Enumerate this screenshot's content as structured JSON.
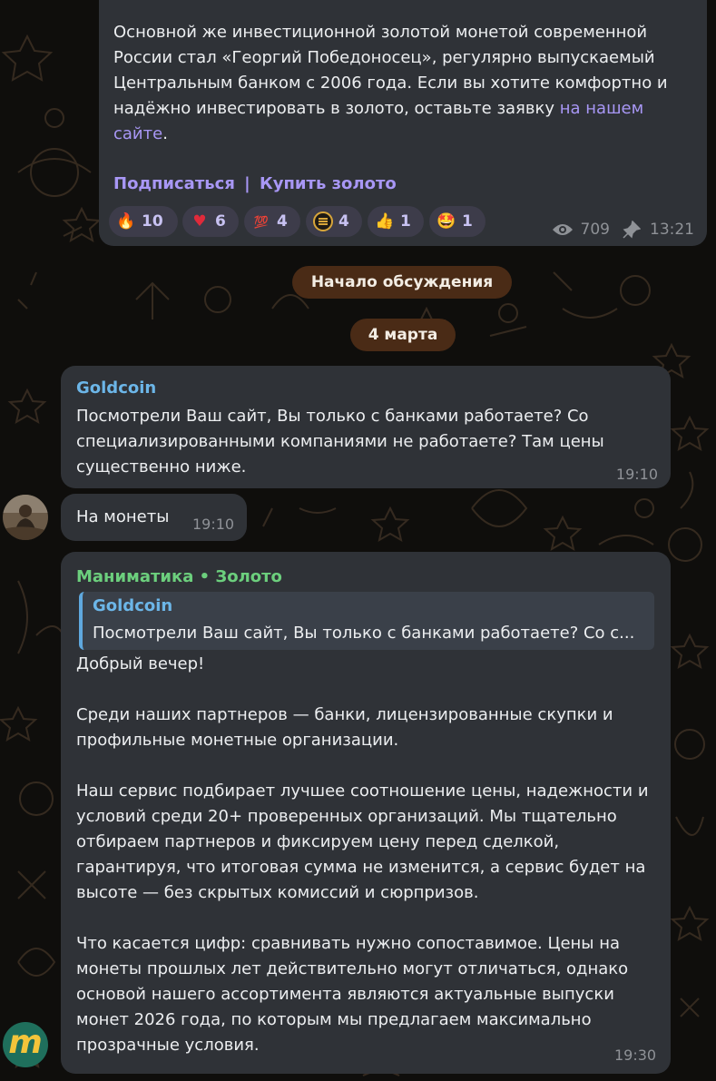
{
  "post": {
    "text": "Основной же инвестиционной золотой монетой современной России стал «Георгий Победоносец», регулярно выпускаемый Центральным банком с 2006 года. Если вы хотите комфортно и надёжно инвестировать в золото, оставьте заявку ",
    "link_text": "на нашем сайте",
    "link_suffix": ".",
    "subscribe_label": "Подписаться",
    "separator": "|",
    "buy_label": "Купить золото",
    "reactions": [
      {
        "icon": "fire-emoji",
        "emoji": "🔥",
        "count": "10"
      },
      {
        "icon": "heart-emoji",
        "emoji": "♥",
        "count": "6"
      },
      {
        "icon": "hundred-emoji",
        "emoji": "💯",
        "count": "4"
      },
      {
        "icon": "gold-logo-emoji",
        "emoji": "",
        "count": "4"
      },
      {
        "icon": "thumbs-up-emoji",
        "emoji": "👍",
        "count": "1"
      },
      {
        "icon": "star-struck-emoji",
        "emoji": "🤩",
        "count": "1"
      }
    ],
    "views": "709",
    "time": "13:21"
  },
  "discussion_label": "Начало обсуждения",
  "date_label": "4 марта",
  "messages": [
    {
      "author": "Goldcoin",
      "text": "Посмотрели Ваш сайт, Вы только с банками работаете? Со специализированными компаниями не работаете? Там цены существенно ниже.",
      "time": "19:10"
    },
    {
      "text": "На монеты",
      "time": "19:10"
    },
    {
      "author": "Маниматика • Золото",
      "reply_author": "Goldcoin",
      "reply_text": "Посмотрели Ваш сайт, Вы только с банками работаете? Со с...",
      "paragraphs": [
        "Добрый вечер!",
        "Среди наших партнеров — банки, лицензированные скупки и профильные монетные организации.",
        "Наш сервис подбирает лучшее соотношение цены, надежности и условий среди 20+ проверенных организаций. Мы тщательно отбираем партнеров и фиксируем цену перед сделкой, гарантируя, что итоговая сумма не изменится, а сервис будет на высоте — без скрытых комиссий и сюрпризов.",
        "Что касается цифр: сравнивать нужно сопоставимое. Цены на монеты прошлых лет действительно могут отличаться, однако основой нашего ассортимента являются актуальные выпуски монет 2026 года, по которым мы предлагаем максимально прозрачные условия."
      ],
      "time": "19:30",
      "avatar_letter": "m"
    }
  ],
  "colors": {
    "background": "#0f0e0c",
    "bubble": "#2f3237",
    "link": "#a897f5",
    "author_blue": "#6cb6e8",
    "author_green": "#6ccf7d",
    "service_pill": "#4a2b16"
  }
}
